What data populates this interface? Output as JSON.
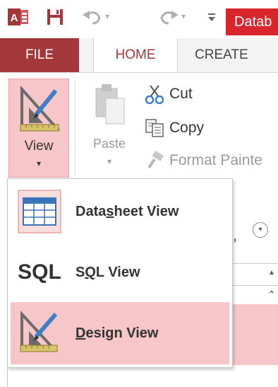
{
  "quick_access": {
    "app_icon": "access-app-icon",
    "save_icon": "save-icon",
    "undo_icon": "undo-icon",
    "redo_icon": "redo-icon",
    "customize_icon": "customize-qat-icon",
    "title_text": "Datab"
  },
  "tabs": [
    {
      "label": "FILE"
    },
    {
      "label": "HOME"
    },
    {
      "label": "CREATE"
    }
  ],
  "ribbon": {
    "view_label": "View",
    "view_arrow": "▾",
    "paste_label": "Paste",
    "paste_arrow": "▾",
    "cut_label": "Cut",
    "copy_label": "Copy",
    "format_painter_label": "Format Painte"
  },
  "view_menu": {
    "items": [
      {
        "label_pre": "Data",
        "label_accel": "s",
        "label_post": "heet View",
        "icon": "datasheet-icon"
      },
      {
        "label_pre": "S",
        "label_accel": "Q",
        "label_post": "L View",
        "icon": "sql-icon",
        "icon_text": "SQL"
      },
      {
        "label_pre": "",
        "label_accel": "D",
        "label_post": "esign View",
        "icon": "design-view-icon",
        "selected": true
      }
    ]
  },
  "colors": {
    "accent": "#a4373a",
    "highlight": "#f6c6c8",
    "title_bar": "#d9252b"
  }
}
